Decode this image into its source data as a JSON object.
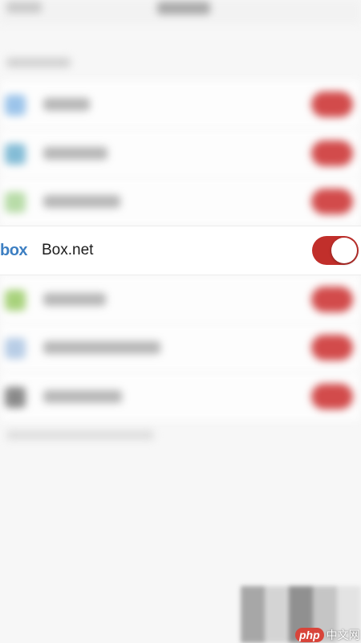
{
  "focused_row": {
    "logo_text": "box",
    "label": "Box.net",
    "toggle_state": "on",
    "toggle_color": "#c12f2b"
  },
  "watermark": {
    "brand": "php",
    "site": "中文网"
  },
  "colors": {
    "accent": "#c12f2b",
    "logo_blue": "#3d7fc2"
  }
}
